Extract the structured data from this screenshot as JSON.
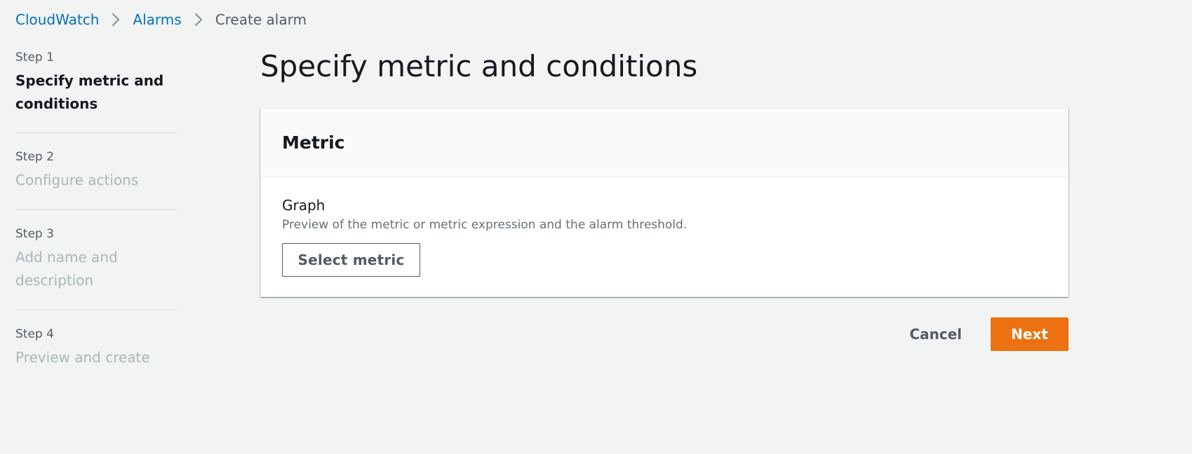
{
  "breadcrumb": {
    "items": [
      "CloudWatch",
      "Alarms"
    ],
    "current": "Create alarm"
  },
  "steps": [
    {
      "number": "Step 1",
      "title": "Specify metric and conditions",
      "active": true
    },
    {
      "number": "Step 2",
      "title": "Configure actions",
      "active": false
    },
    {
      "number": "Step 3",
      "title": "Add name and description",
      "active": false
    },
    {
      "number": "Step 4",
      "title": "Preview and create",
      "active": false
    }
  ],
  "main": {
    "title": "Specify metric and conditions",
    "metric_panel": {
      "title": "Metric",
      "graph_label": "Graph",
      "graph_description": "Preview of the metric or metric expression and the alarm threshold.",
      "select_metric_label": "Select metric"
    }
  },
  "actions": {
    "cancel_label": "Cancel",
    "next_label": "Next"
  },
  "colors": {
    "link": "#0073bb",
    "primary": "#ec7211",
    "background": "#f2f3f3",
    "disabled_text": "#aab7b8"
  },
  "icons": {
    "breadcrumb_separator": "chevron-right-icon"
  }
}
